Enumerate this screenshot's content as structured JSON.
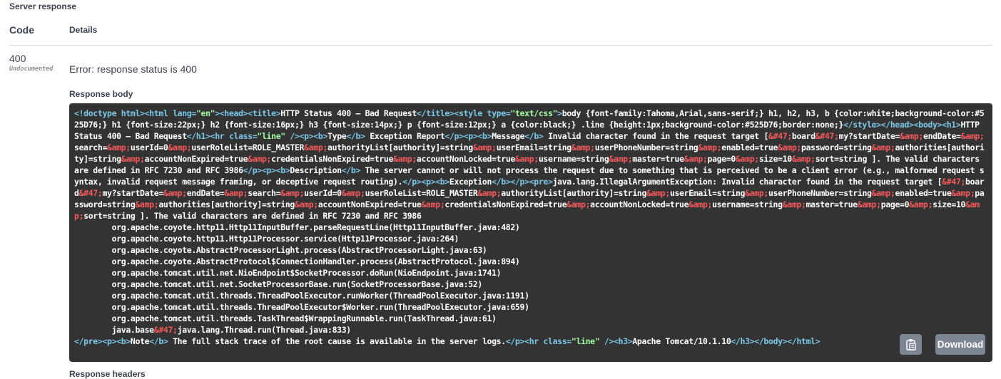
{
  "section": {
    "title": "Server response"
  },
  "table_header": {
    "code": "Code",
    "details": "Details"
  },
  "response": {
    "status_code": "400",
    "undocumented": "Undocumented",
    "error": "Error: response status is 400",
    "body_label": "Response body",
    "headers_label": "Response headers"
  },
  "body_segments": [
    {
      "c": "tag",
      "t": "<!doctype html>"
    },
    {
      "c": "tag",
      "t": "<html "
    },
    {
      "c": "tag",
      "t": "lang="
    },
    {
      "c": "str",
      "t": "\"en\""
    },
    {
      "c": "tag",
      "t": ">"
    },
    {
      "c": "tag",
      "t": "<head>"
    },
    {
      "c": "tag",
      "t": "<title>"
    },
    {
      "c": "txt",
      "t": "HTTP Status 400 – Bad Request"
    },
    {
      "c": "tag",
      "t": "</title>"
    },
    {
      "c": "tag",
      "t": "<style "
    },
    {
      "c": "tag",
      "t": "type="
    },
    {
      "c": "str",
      "t": "\"text/css\""
    },
    {
      "c": "tag",
      "t": ">"
    },
    {
      "c": "txt",
      "t": "body {font-family:Tahoma,Arial,sans-serif;} h1, h2, h3, b {color:white;background-color:#525D76;} h1 {font-size:22px;} h2 {font-size:16px;} h3 {font-size:14px;} p {font-size:12px;} a {color:black;} .line {height:1px;background-color:#525D76;border:none;}"
    },
    {
      "c": "tag",
      "t": "</style>"
    },
    {
      "c": "tag",
      "t": "</head>"
    },
    {
      "c": "tag",
      "t": "<body>"
    },
    {
      "c": "tag",
      "t": "<h1>"
    },
    {
      "c": "txt",
      "t": "HTTP Status 400 – Bad Request"
    },
    {
      "c": "tag",
      "t": "</h1>"
    },
    {
      "c": "tag",
      "t": "<hr "
    },
    {
      "c": "tag",
      "t": "class="
    },
    {
      "c": "str",
      "t": "\"line\""
    },
    {
      "c": "tag",
      "t": " />"
    },
    {
      "c": "tag",
      "t": "<p>"
    },
    {
      "c": "tag",
      "t": "<b>"
    },
    {
      "c": "txt",
      "t": "Type"
    },
    {
      "c": "tag",
      "t": "</b>"
    },
    {
      "c": "txt",
      "t": " Exception Report"
    },
    {
      "c": "tag",
      "t": "</p>"
    },
    {
      "c": "tag",
      "t": "<p>"
    },
    {
      "c": "tag",
      "t": "<b>"
    },
    {
      "c": "txt",
      "t": "Message"
    },
    {
      "c": "tag",
      "t": "</b>"
    },
    {
      "c": "txt",
      "t": " Invalid character found in the request target ["
    },
    {
      "c": "ent",
      "t": "&#47;"
    },
    {
      "c": "txt",
      "t": "board"
    },
    {
      "c": "ent",
      "t": "&#47;"
    },
    {
      "c": "txt",
      "t": "my?startDate="
    },
    {
      "c": "ent",
      "t": "&amp;"
    },
    {
      "c": "txt",
      "t": "endDate="
    },
    {
      "c": "ent",
      "t": "&amp;"
    },
    {
      "c": "txt",
      "t": "search="
    },
    {
      "c": "ent",
      "t": "&amp;"
    },
    {
      "c": "txt",
      "t": "userId=0"
    },
    {
      "c": "ent",
      "t": "&amp;"
    },
    {
      "c": "txt",
      "t": "userRoleList=ROLE_MASTER"
    },
    {
      "c": "ent",
      "t": "&amp;"
    },
    {
      "c": "txt",
      "t": "authorityList[authority]=string"
    },
    {
      "c": "ent",
      "t": "&amp;"
    },
    {
      "c": "txt",
      "t": "userEmail=string"
    },
    {
      "c": "ent",
      "t": "&amp;"
    },
    {
      "c": "txt",
      "t": "userPhoneNumber=string"
    },
    {
      "c": "ent",
      "t": "&amp;"
    },
    {
      "c": "txt",
      "t": "enabled=true"
    },
    {
      "c": "ent",
      "t": "&amp;"
    },
    {
      "c": "txt",
      "t": "password=string"
    },
    {
      "c": "ent",
      "t": "&amp;"
    },
    {
      "c": "txt",
      "t": "authorities[authority]=string"
    },
    {
      "c": "ent",
      "t": "&amp;"
    },
    {
      "c": "txt",
      "t": "accountNonExpired=true"
    },
    {
      "c": "ent",
      "t": "&amp;"
    },
    {
      "c": "txt",
      "t": "credentialsNonExpired=true"
    },
    {
      "c": "ent",
      "t": "&amp;"
    },
    {
      "c": "txt",
      "t": "accountNonLocked=true"
    },
    {
      "c": "ent",
      "t": "&amp;"
    },
    {
      "c": "txt",
      "t": "username=string"
    },
    {
      "c": "ent",
      "t": "&amp;"
    },
    {
      "c": "txt",
      "t": "master=true"
    },
    {
      "c": "ent",
      "t": "&amp;"
    },
    {
      "c": "txt",
      "t": "page=0"
    },
    {
      "c": "ent",
      "t": "&amp;"
    },
    {
      "c": "txt",
      "t": "size=10"
    },
    {
      "c": "ent",
      "t": "&amp;"
    },
    {
      "c": "txt",
      "t": "sort=string ]. The valid characters are defined in RFC 7230 and RFC 3986"
    },
    {
      "c": "tag",
      "t": "</p>"
    },
    {
      "c": "tag",
      "t": "<p>"
    },
    {
      "c": "tag",
      "t": "<b>"
    },
    {
      "c": "txt",
      "t": "Description"
    },
    {
      "c": "tag",
      "t": "</b>"
    },
    {
      "c": "txt",
      "t": " The server cannot or will not process the request due to something that is perceived to be a client error (e.g., malformed request syntax, invalid request message framing, or deceptive request routing)."
    },
    {
      "c": "tag",
      "t": "</p>"
    },
    {
      "c": "tag",
      "t": "<p>"
    },
    {
      "c": "tag",
      "t": "<b>"
    },
    {
      "c": "txt",
      "t": "Exception"
    },
    {
      "c": "tag",
      "t": "</b>"
    },
    {
      "c": "tag",
      "t": "</p>"
    },
    {
      "c": "tag",
      "t": "<pre>"
    },
    {
      "c": "txt",
      "t": "java.lang.IllegalArgumentException: Invalid character found in the request target ["
    },
    {
      "c": "ent",
      "t": "&#47;"
    },
    {
      "c": "txt",
      "t": "board"
    },
    {
      "c": "ent",
      "t": "&#47;"
    },
    {
      "c": "txt",
      "t": "my?startDate="
    },
    {
      "c": "ent",
      "t": "&amp;"
    },
    {
      "c": "txt",
      "t": "endDate="
    },
    {
      "c": "ent",
      "t": "&amp;"
    },
    {
      "c": "txt",
      "t": "search="
    },
    {
      "c": "ent",
      "t": "&amp;"
    },
    {
      "c": "txt",
      "t": "userId=0"
    },
    {
      "c": "ent",
      "t": "&amp;"
    },
    {
      "c": "txt",
      "t": "userRoleList=ROLE_MASTER"
    },
    {
      "c": "ent",
      "t": "&amp;"
    },
    {
      "c": "txt",
      "t": "authorityList[authority]=string"
    },
    {
      "c": "ent",
      "t": "&amp;"
    },
    {
      "c": "txt",
      "t": "userEmail=string"
    },
    {
      "c": "ent",
      "t": "&amp;"
    },
    {
      "c": "txt",
      "t": "userPhoneNumber=string"
    },
    {
      "c": "ent",
      "t": "&amp;"
    },
    {
      "c": "txt",
      "t": "enabled=true"
    },
    {
      "c": "ent",
      "t": "&amp;"
    },
    {
      "c": "txt",
      "t": "password=string"
    },
    {
      "c": "ent",
      "t": "&amp;"
    },
    {
      "c": "txt",
      "t": "authorities[authority]=string"
    },
    {
      "c": "ent",
      "t": "&amp;"
    },
    {
      "c": "txt",
      "t": "accountNonExpired=true"
    },
    {
      "c": "ent",
      "t": "&amp;"
    },
    {
      "c": "txt",
      "t": "credentialsNonExpired=true"
    },
    {
      "c": "ent",
      "t": "&amp;"
    },
    {
      "c": "txt",
      "t": "accountNonLocked=true"
    },
    {
      "c": "ent",
      "t": "&amp;"
    },
    {
      "c": "txt",
      "t": "username=string"
    },
    {
      "c": "ent",
      "t": "&amp;"
    },
    {
      "c": "txt",
      "t": "master=true"
    },
    {
      "c": "ent",
      "t": "&amp;"
    },
    {
      "c": "txt",
      "t": "page=0"
    },
    {
      "c": "ent",
      "t": "&amp;"
    },
    {
      "c": "txt",
      "t": "size=10"
    },
    {
      "c": "ent",
      "t": "&amp;"
    },
    {
      "c": "txt",
      "t": "sort=string ]. The valid characters are defined in RFC 7230 and RFC 3986\n\torg.apache.coyote.http11.Http11InputBuffer.parseRequestLine(Http11InputBuffer.java:482)\n\torg.apache.coyote.http11.Http11Processor.service(Http11Processor.java:264)\n\torg.apache.coyote.AbstractProcessorLight.process(AbstractProcessorLight.java:63)\n\torg.apache.coyote.AbstractProtocol$ConnectionHandler.process(AbstractProtocol.java:894)\n\torg.apache.tomcat.util.net.NioEndpoint$SocketProcessor.doRun(NioEndpoint.java:1741)\n\torg.apache.tomcat.util.net.SocketProcessorBase.run(SocketProcessorBase.java:52)\n\torg.apache.tomcat.util.threads.ThreadPoolExecutor.runWorker(ThreadPoolExecutor.java:1191)\n\torg.apache.tomcat.util.threads.ThreadPoolExecutor$Worker.run(ThreadPoolExecutor.java:659)\n\torg.apache.tomcat.util.threads.TaskThread$WrappingRunnable.run(TaskThread.java:61)\n\tjava.base"
    },
    {
      "c": "ent",
      "t": "&#47;"
    },
    {
      "c": "txt",
      "t": "java.lang.Thread.run(Thread.java:833)\n"
    },
    {
      "c": "tag",
      "t": "</pre>"
    },
    {
      "c": "tag",
      "t": "<p>"
    },
    {
      "c": "tag",
      "t": "<b>"
    },
    {
      "c": "txt",
      "t": "Note"
    },
    {
      "c": "tag",
      "t": "</b>"
    },
    {
      "c": "txt",
      "t": " The full stack trace of the root cause is available in the server logs."
    },
    {
      "c": "tag",
      "t": "</p>"
    },
    {
      "c": "tag",
      "t": "<hr "
    },
    {
      "c": "tag",
      "t": "class="
    },
    {
      "c": "str",
      "t": "\"line\""
    },
    {
      "c": "tag",
      "t": " />"
    },
    {
      "c": "tag",
      "t": "<h3>"
    },
    {
      "c": "txt",
      "t": "Apache Tomcat/10.1.10"
    },
    {
      "c": "tag",
      "t": "</h3>"
    },
    {
      "c": "tag",
      "t": "</body>"
    },
    {
      "c": "tag",
      "t": "</html>"
    }
  ],
  "actions": {
    "copy_icon": "clipboard-icon",
    "download_label": "Download"
  },
  "colors": {
    "code_bg": "#333333",
    "tag": "#7bc8e8",
    "string": "#a2fca2",
    "entity": "#f5595b",
    "button_bg": "#7d8492"
  }
}
